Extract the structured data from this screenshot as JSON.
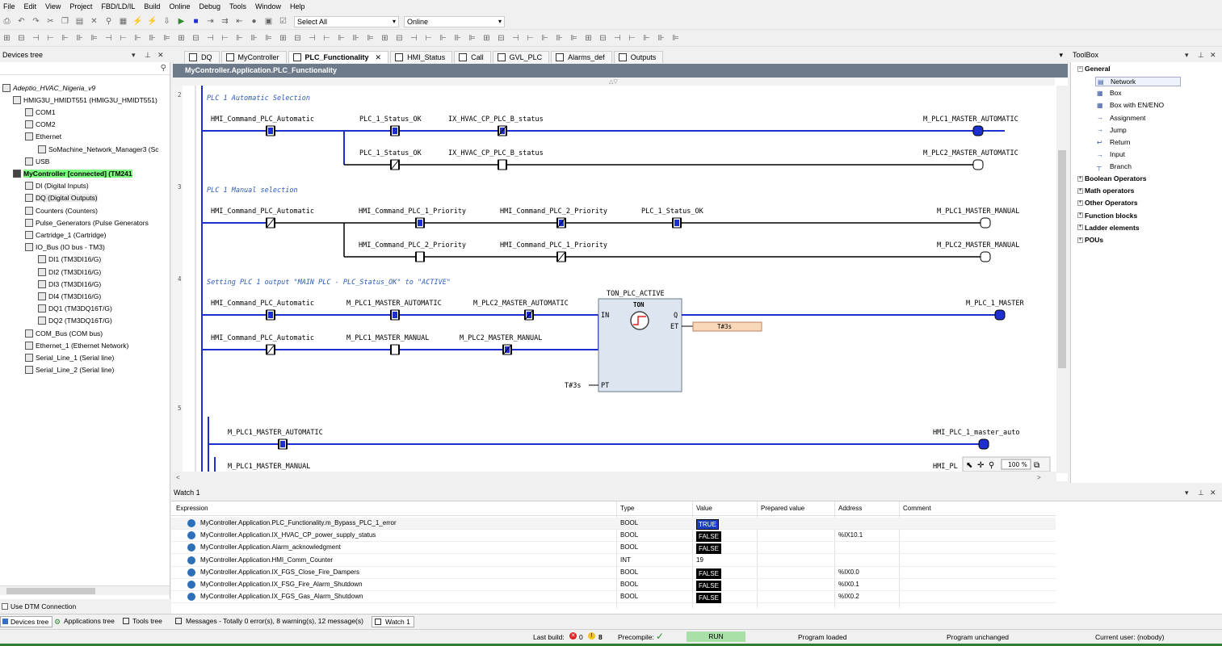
{
  "menu": [
    "File",
    "Edit",
    "View",
    "Project",
    "FBD/LD/IL",
    "Build",
    "Online",
    "Debug",
    "Tools",
    "Window",
    "Help"
  ],
  "toolbar": {
    "select_all": "Select All",
    "online": "Online"
  },
  "devices_tree": {
    "title": "Devices tree",
    "items": [
      {
        "label": "Adeptio_HVAC_Nigeria_v9",
        "level": 0
      },
      {
        "label": "HMIG3U_HMIDT551 (HMIG3U_HMIDT551)",
        "level": 1
      },
      {
        "label": "COM1",
        "level": 2
      },
      {
        "label": "COM2",
        "level": 2
      },
      {
        "label": "Ethernet",
        "level": 2
      },
      {
        "label": "SoMachine_Network_Manager3 (Sc",
        "level": 3
      },
      {
        "label": "USB",
        "level": 2
      },
      {
        "label": "MyController [connected] (TM241",
        "level": 1
      },
      {
        "label": "DI (Digital Inputs)",
        "level": 2
      },
      {
        "label": "DQ (Digital Outputs)",
        "level": 2
      },
      {
        "label": "Counters (Counters)",
        "level": 2
      },
      {
        "label": "Pulse_Generators (Pulse Generators",
        "level": 2
      },
      {
        "label": "Cartridge_1 (Cartridge)",
        "level": 2
      },
      {
        "label": "IO_Bus (IO bus - TM3)",
        "level": 2
      },
      {
        "label": "DI1 (TM3DI16/G)",
        "level": 3
      },
      {
        "label": "DI2 (TM3DI16/G)",
        "level": 3
      },
      {
        "label": "DI3 (TM3DI16/G)",
        "level": 3
      },
      {
        "label": "DI4 (TM3DI16/G)",
        "level": 3
      },
      {
        "label": "DQ1 (TM3DQ16T/G)",
        "level": 3
      },
      {
        "label": "DQ2 (TM3DQ16T/G)",
        "level": 3
      },
      {
        "label": "COM_Bus (COM bus)",
        "level": 2
      },
      {
        "label": "Ethernet_1 (Ethernet Network)",
        "level": 2
      },
      {
        "label": "Serial_Line_1 (Serial line)",
        "level": 2
      },
      {
        "label": "Serial_Line_2 (Serial line)",
        "level": 2
      }
    ],
    "use_dtm": "Use DTM Connection"
  },
  "tabs": [
    "DQ",
    "MyController",
    "PLC_Functionality",
    "HMI_Status",
    "Call",
    "GVL_PLC",
    "Alarms_def",
    "Outputs"
  ],
  "active_tab": "PLC_Functionality",
  "editor_path": "MyController.Application.PLC_Functionality",
  "ladder": {
    "rung_numbers": [
      "2",
      "3",
      "4",
      "5"
    ],
    "comments": [
      "PLC 1 Automatic Selection",
      "PLC 1 Manual selection",
      "Setting PLC 1 output \"MAIN PLC - PLC_Status_OK\" to \"ACTIVE\""
    ],
    "r2a": [
      "HMI_Command_PLC_Automatic",
      "PLC_1_Status_OK",
      "IX_HVAC_CP_PLC_B_status",
      "M_PLC1_MASTER_AUTOMATIC"
    ],
    "r2b": [
      "PLC_1_Status_OK",
      "IX_HVAC_CP_PLC_B_status",
      "M_PLC2_MASTER_AUTOMATIC"
    ],
    "r3a": [
      "HMI_Command_PLC_Automatic",
      "HMI_Command_PLC_1_Priority",
      "HMI_Command_PLC_2_Priority",
      "PLC_1_Status_OK",
      "M_PLC1_MASTER_MANUAL"
    ],
    "r3b": [
      "HMI_Command_PLC_2_Priority",
      "HMI_Command_PLC_1_Priority",
      "M_PLC2_MASTER_MANUAL"
    ],
    "r4a": [
      "HMI_Command_PLC_Automatic",
      "M_PLC1_MASTER_AUTOMATIC",
      "M_PLC2_MASTER_AUTOMATIC",
      "M_PLC_1_MASTER"
    ],
    "r4b": [
      "HMI_Command_PLC_Automatic",
      "M_PLC1_MASTER_MANUAL",
      "M_PLC2_MASTER_MANUAL"
    ],
    "timer": {
      "name": "TON_PLC_ACTIVE",
      "type": "TON",
      "in": "IN",
      "q": "Q",
      "et": "ET",
      "pt": "PT",
      "et_value": "T#3s",
      "pt_value": "T#3s"
    },
    "r5a": [
      "M_PLC1_MASTER_AUTOMATIC",
      "HMI_PLC_1_master_auto"
    ],
    "r5b": [
      "M_PLC1_MASTER_MANUAL",
      "HMI_PL"
    ],
    "zoom": "100 %"
  },
  "toolbox": {
    "title": "ToolBox",
    "general": "General",
    "items": [
      "Network",
      "Box",
      "Box with EN/ENO",
      "Assignment",
      "Jump",
      "Return",
      "Input",
      "Branch"
    ],
    "categories": [
      "Boolean Operators",
      "Math operators",
      "Other Operators",
      "Function blocks",
      "Ladder elements",
      "POUs"
    ]
  },
  "watch": {
    "title": "Watch 1",
    "columns": [
      "Expression",
      "Type",
      "Value",
      "Prepared value",
      "Address",
      "Comment"
    ],
    "rows": [
      {
        "expr": "MyController.Application.PLC_Functionality.m_Bypass_PLC_1_error",
        "type": "BOOL",
        "value": "TRUE",
        "address": ""
      },
      {
        "expr": "MyController.Application.IX_HVAC_CP_power_supply_status",
        "type": "BOOL",
        "value": "FALSE",
        "address": "%IX10.1"
      },
      {
        "expr": "MyController.Application.Alarm_acknowledgment",
        "type": "BOOL",
        "value": "FALSE",
        "address": ""
      },
      {
        "expr": "MyController.Application.HMI_Comm_Counter",
        "type": "INT",
        "value": "19",
        "address": ""
      },
      {
        "expr": "MyController.Application.IX_FGS_Close_Fire_Dampers",
        "type": "BOOL",
        "value": "FALSE",
        "address": "%IX0.0"
      },
      {
        "expr": "MyController.Application.IX_FSG_Fire_Alarm_Shutdown",
        "type": "BOOL",
        "value": "FALSE",
        "address": "%IX0.1"
      },
      {
        "expr": "MyController.Application.IX_FGS_Gas_Alarm_Shutdown",
        "type": "BOOL",
        "value": "FALSE",
        "address": "%IX0.2"
      }
    ]
  },
  "bottom_tabs": [
    "Devices tree",
    "Applications tree",
    "Tools tree"
  ],
  "bottom_tabs_right": [
    "Messages - Totally 0 error(s), 8 warning(s), 12 message(s)",
    "Watch 1"
  ],
  "status": {
    "last_build": "Last build:",
    "errors": "0",
    "warnings": "8",
    "precompile": "Precompile:",
    "run": "RUN",
    "program_loaded": "Program loaded",
    "program_unchanged": "Program unchanged",
    "current_user": "Current user: (nobody)"
  },
  "colors": {
    "rail": "#1e2fd0",
    "contact_fill": "#1e2fd0",
    "status_green": "#a8e0a8",
    "connected_green": "#7cfc7c"
  }
}
